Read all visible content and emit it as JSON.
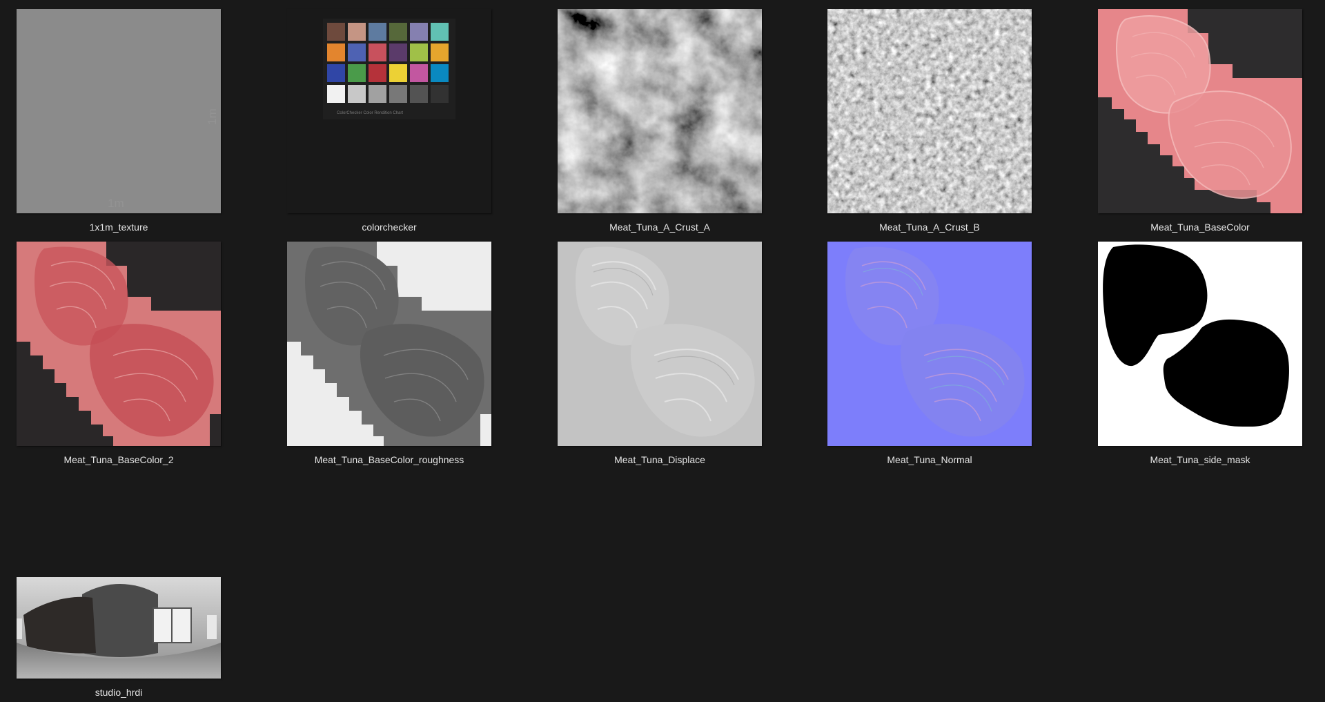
{
  "items": [
    {
      "name": "1x1m_texture",
      "mark": "1m"
    },
    {
      "name": "colorchecker",
      "card_text": "ColorChecker Color Rendition Chart"
    },
    {
      "name": "Meat_Tuna_A_Crust_A"
    },
    {
      "name": "Meat_Tuna_A_Crust_B"
    },
    {
      "name": "Meat_Tuna_BaseColor"
    },
    {
      "name": "Meat_Tuna_BaseColor_2"
    },
    {
      "name": "Meat_Tuna_BaseColor_roughness"
    },
    {
      "name": "Meat_Tuna_Displace"
    },
    {
      "name": "Meat_Tuna_Normal"
    },
    {
      "name": "Meat_Tuna_side_mask"
    },
    {
      "name": "studio_hrdi"
    }
  ],
  "colors": {
    "background": "#191919",
    "label": "#e6e6e6",
    "normal_map": "#7d7efb",
    "tuna": "#e07d80"
  },
  "colorchecker_swatches": [
    "#6e4a3d",
    "#c59584",
    "#5e7ba0",
    "#56683a",
    "#8580b0",
    "#61c1b3",
    "#e3852e",
    "#4e62b3",
    "#c8515d",
    "#5b3b6a",
    "#a0c048",
    "#e5a52d",
    "#3046a6",
    "#4a9b4a",
    "#b5323a",
    "#ecd135",
    "#c257a0",
    "#0a89c0",
    "#f1f1f1",
    "#c8c8c8",
    "#a1a1a1",
    "#787878",
    "#535353",
    "#323232"
  ]
}
